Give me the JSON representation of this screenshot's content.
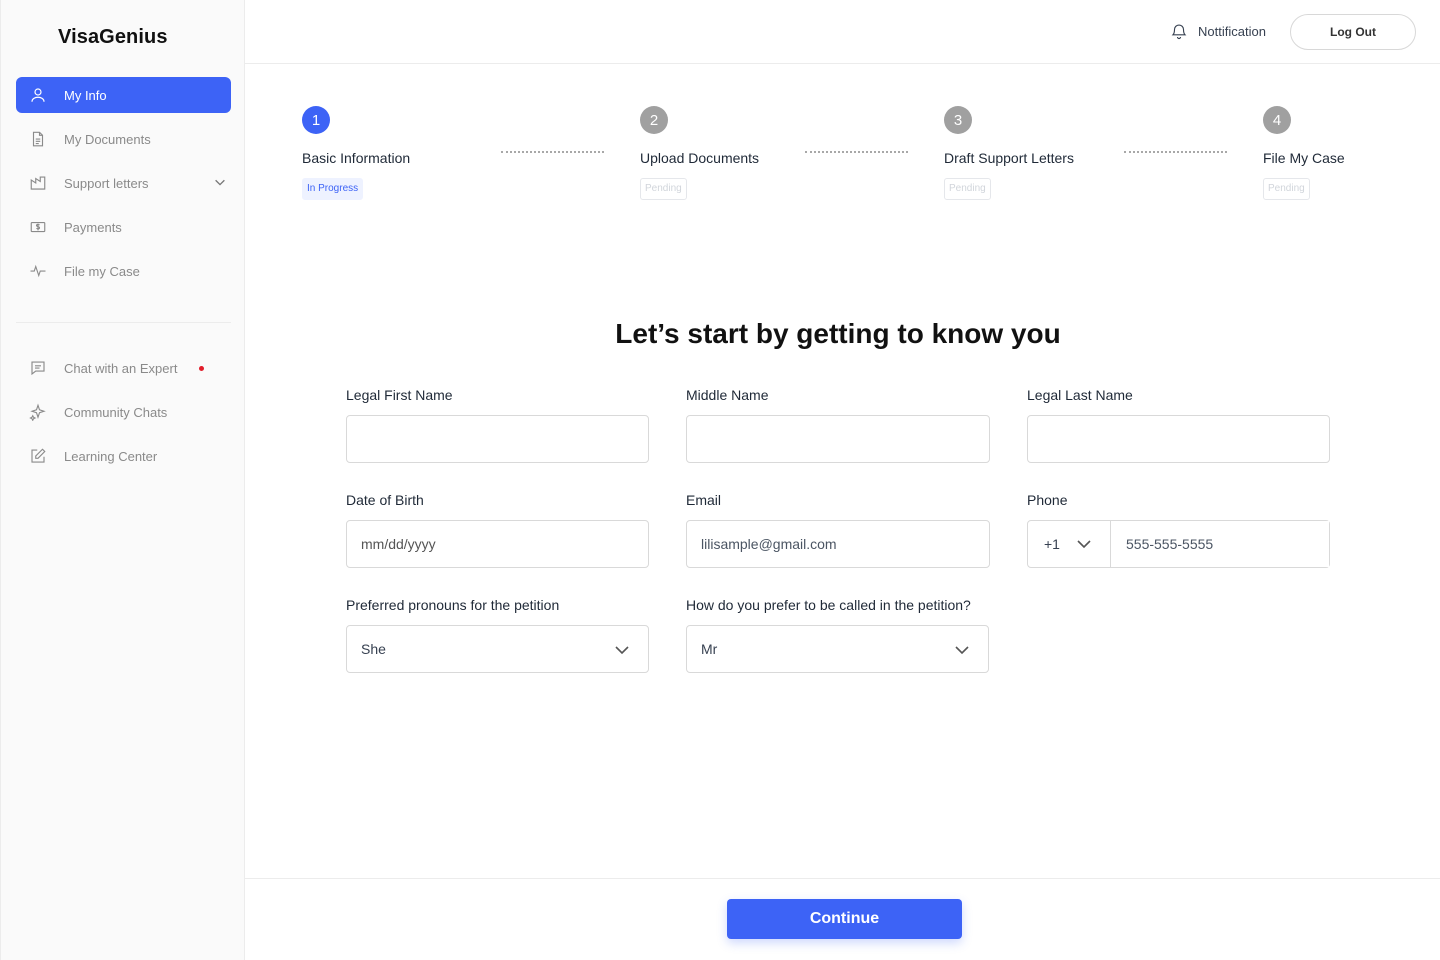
{
  "brand": "VisaGenius",
  "sidebar": {
    "items": [
      {
        "label": "My Info",
        "icon": "user-icon",
        "active": true
      },
      {
        "label": "My Documents",
        "icon": "document-icon"
      },
      {
        "label": "Support letters",
        "icon": "letter-icon",
        "expandable": true
      },
      {
        "label": "Payments",
        "icon": "money-icon"
      },
      {
        "label": "File my Case",
        "icon": "activity-icon"
      }
    ],
    "secondary_items": [
      {
        "label": "Chat with an Expert",
        "icon": "chat-icon",
        "unread": true
      },
      {
        "label": "Community Chats",
        "icon": "sparkle-icon"
      },
      {
        "label": "Learning Center",
        "icon": "edit-icon"
      }
    ]
  },
  "header": {
    "notification_label": "Nottification",
    "logout_label": "Log Out"
  },
  "steps": [
    {
      "number": "1",
      "label": "Basic Information",
      "status": "In Progress"
    },
    {
      "number": "2",
      "label": "Upload Documents",
      "status": "Pending"
    },
    {
      "number": "3",
      "label": "Draft Support Letters",
      "status": "Pending"
    },
    {
      "number": "4",
      "label": "File My Case",
      "status": "Pending"
    }
  ],
  "form": {
    "title": "Let’s start by getting to know you",
    "first_name": {
      "label": "Legal First Name",
      "value": ""
    },
    "middle_name": {
      "label": "Middle Name",
      "value": ""
    },
    "last_name": {
      "label": "Legal Last Name",
      "value": ""
    },
    "dob": {
      "label": "Date of Birth",
      "placeholder": "mm/dd/yyyy"
    },
    "email": {
      "label": "Email",
      "value": "lilisample@gmail.com"
    },
    "phone": {
      "label": "Phone",
      "country_code": "+1",
      "value": "555-555-5555"
    },
    "pronouns": {
      "label": "Preferred pronouns for the petition",
      "value": "She"
    },
    "title_pref": {
      "label": "How do you prefer to be called in the petition?",
      "value": "Mr"
    }
  },
  "footer": {
    "continue_label": "Continue"
  },
  "colors": {
    "accent": "#3d63f6",
    "inactive_step": "#a0a0a0",
    "unread_dot": "#e11d2a"
  }
}
